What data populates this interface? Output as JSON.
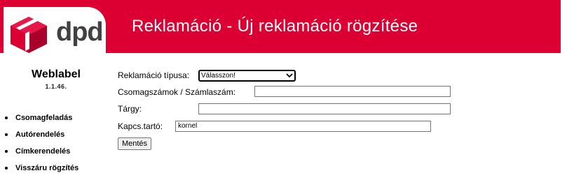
{
  "header": {
    "title": "Reklamáció - Új reklamáció rögzítése"
  },
  "logo": {
    "text": "dpd",
    "brand_color": "#dc0032"
  },
  "sidebar": {
    "brand": "Weblabel",
    "version": "1.1.46.",
    "items": [
      {
        "label": "Csomagfeladás"
      },
      {
        "label": "Autórendelés"
      },
      {
        "label": "Címkerendelés"
      },
      {
        "label": "Visszáru rögzítés"
      }
    ]
  },
  "form": {
    "type_label": "Reklamáció típusa:",
    "type_value": "Válasszon!",
    "parcels_label": "Csomagszámok / Számlaszám:",
    "parcels_value": "",
    "subject_label": "Tárgy:",
    "subject_value": "",
    "contact_label": "Kapcs.tartó:",
    "contact_value": "kornel",
    "save_label": "Mentés"
  }
}
